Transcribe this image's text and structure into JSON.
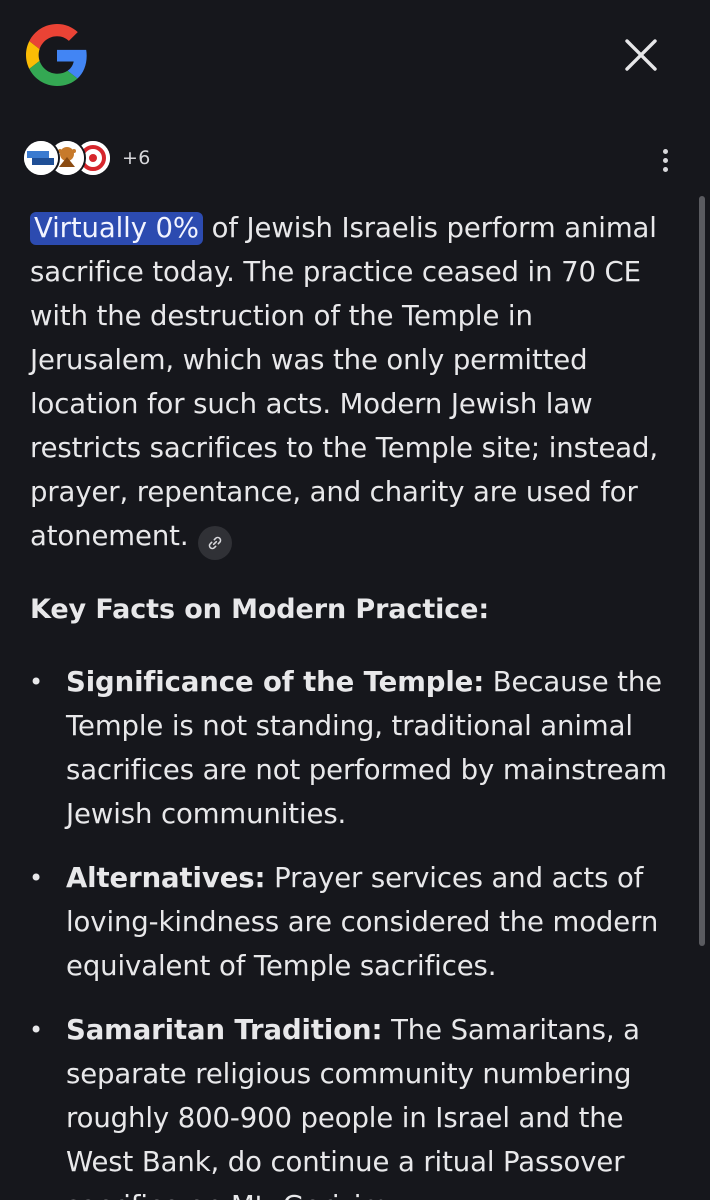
{
  "header": {
    "logo": "google-g-logo",
    "close_icon": "close-icon"
  },
  "sources": {
    "more_count": "+6",
    "favicons": [
      "source-favicon-1",
      "source-favicon-2",
      "source-favicon-3"
    ]
  },
  "menu_icon": "more-vert-icon",
  "summary": {
    "highlight": "Virtually 0%",
    "text": " of Jewish Israelis perform animal sacrifice today. The practice ceased in 70 CE with the destruction of the Temple in Jerusalem, which was the only permitted location for such acts. Modern Jewish law restricts sacrifices to the Temple site; instead, prayer, repentance, and charity are used for atonement.",
    "link_icon": "link-icon"
  },
  "key_facts": {
    "title": "Key Facts on Modern Practice:",
    "items": [
      {
        "label": "Significance of the Temple:",
        "text": " Because the Temple is not standing, traditional animal sacrifices are not performed by mainstream Jewish communities."
      },
      {
        "label": "Alternatives:",
        "text": " Prayer services and acts of loving-kindness are considered the modern equivalent of Temple sacrifices."
      },
      {
        "label": "Samaritan Tradition:",
        "text": " The Samaritans, a separate religious community numbering roughly 800-900 people in Israel and the West Bank, do continue a ritual Passover sacrifice on Mt. Gerizim."
      }
    ]
  },
  "colors": {
    "background": "#16171c",
    "text": "#e8e8ea",
    "highlight": "#2c4bb0"
  }
}
